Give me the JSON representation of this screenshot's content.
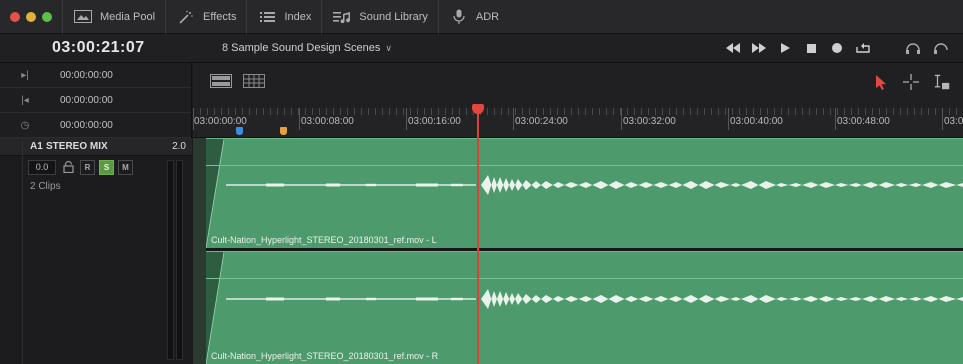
{
  "toolbar": {
    "items": [
      {
        "label": "Media Pool",
        "icon": "media-pool-icon"
      },
      {
        "label": "Effects",
        "icon": "effects-wand-icon"
      },
      {
        "label": "Index",
        "icon": "index-list-icon"
      },
      {
        "label": "Sound Library",
        "icon": "sound-library-icon"
      },
      {
        "label": "ADR",
        "icon": "microphone-icon"
      }
    ],
    "window_dot_colors": [
      "#e5514b",
      "#e0b43c",
      "#5cc149"
    ]
  },
  "header": {
    "timecode": "03:00:21:07",
    "timeline_name": "8 Sample Sound Design Scenes",
    "dropdown_glyph": "∨",
    "transport_icons": [
      "rewind-icon",
      "fast-forward-icon",
      "play-icon",
      "stop-icon",
      "record-icon",
      "loop-icon"
    ]
  },
  "left_panel": {
    "in_tc": "00:00:00:00",
    "out_tc": "00:00:00:00",
    "duration_tc": "00:00:00:00",
    "in_glyph": "▸|",
    "out_glyph": "|◂",
    "duration_glyph": "◷",
    "track": {
      "id": "A1",
      "name": "STEREO MIX",
      "channels": "2.0",
      "volume": "0.0",
      "r_label": "R",
      "s_label": "S",
      "m_label": "M",
      "clip_count": "2 Clips"
    }
  },
  "ruler": {
    "labels": [
      "03:00:00:00",
      "03:00:08:00",
      "03:00:16:00",
      "03:00:24:00",
      "03:00:32:00",
      "03:00:40:00",
      "03:00:48:00",
      "03:0"
    ],
    "marker_colors": [
      "#3f8de0",
      "#e5a13a"
    ]
  },
  "clips": {
    "left_name": "Cult-Nation_Hyperlight_STEREO_20180301_ref.mov - L",
    "right_name": "Cult-Nation_Hyperlight_STEREO_20180301_ref.mov - R",
    "color": "#4d9a6c"
  },
  "colors": {
    "playhead": "#d8413c",
    "solo": "#5a9a42",
    "selection_arrow": "#e4473f"
  }
}
